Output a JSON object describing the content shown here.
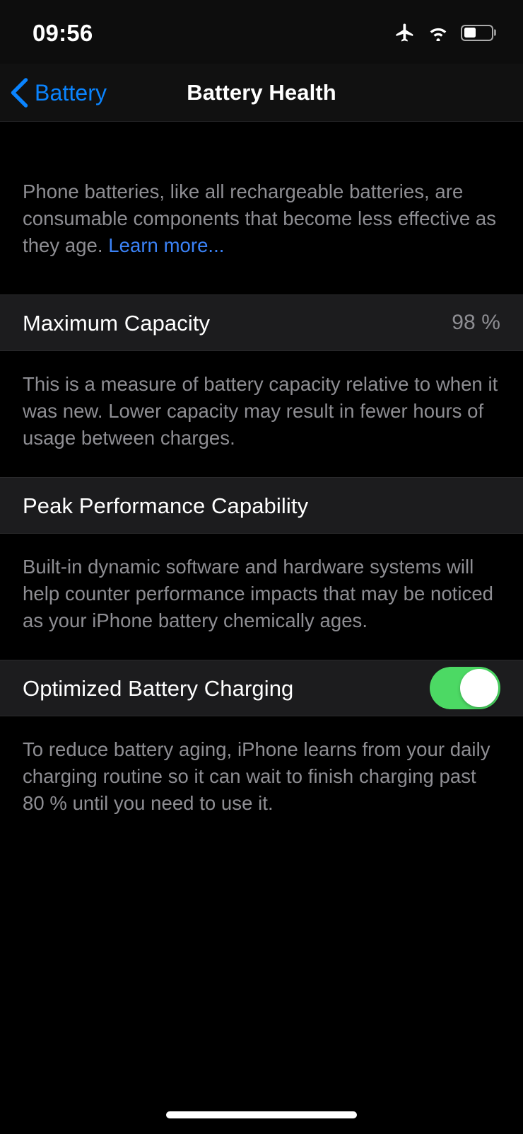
{
  "status_bar": {
    "time": "09:56",
    "airplane_icon": "airplane-mode-icon",
    "wifi_icon": "wifi-icon",
    "battery_icon": "battery-icon",
    "battery_level_percent": 45
  },
  "nav": {
    "back_label": "Battery",
    "back_chevron_icon": "chevron-left-icon",
    "title": "Battery Health"
  },
  "intro": {
    "text": "Phone batteries, like all rechargeable batteries, are consumable components that become less effective as they age. ",
    "link_label": "Learn more..."
  },
  "sections": [
    {
      "id": "maximum-capacity",
      "title": "Maximum Capacity",
      "value": "98 %",
      "description": "This is a measure of battery capacity relative to when it was new. Lower capacity may result in fewer hours of usage between charges."
    },
    {
      "id": "peak-performance-capability",
      "title": "Peak Performance Capability",
      "value": "",
      "description": "Built-in dynamic software and hardware systems will help counter performance impacts that may be noticed as your iPhone battery chemically ages."
    },
    {
      "id": "optimized-battery-charging",
      "title": "Optimized Battery Charging",
      "toggle_on": true,
      "description": "To reduce battery aging, iPhone learns from your daily charging routine so it can wait to finish charging past 80 % until you need to use it."
    }
  ],
  "colors": {
    "page_background": "#000000",
    "row_background": "#1c1c1e",
    "accent_blue": "#0a84ff",
    "link_blue": "#3b82f6",
    "toggle_green": "#4cd964",
    "secondary_text": "#8e8e93",
    "primary_text": "#ffffff"
  },
  "home_indicator": "home-indicator"
}
